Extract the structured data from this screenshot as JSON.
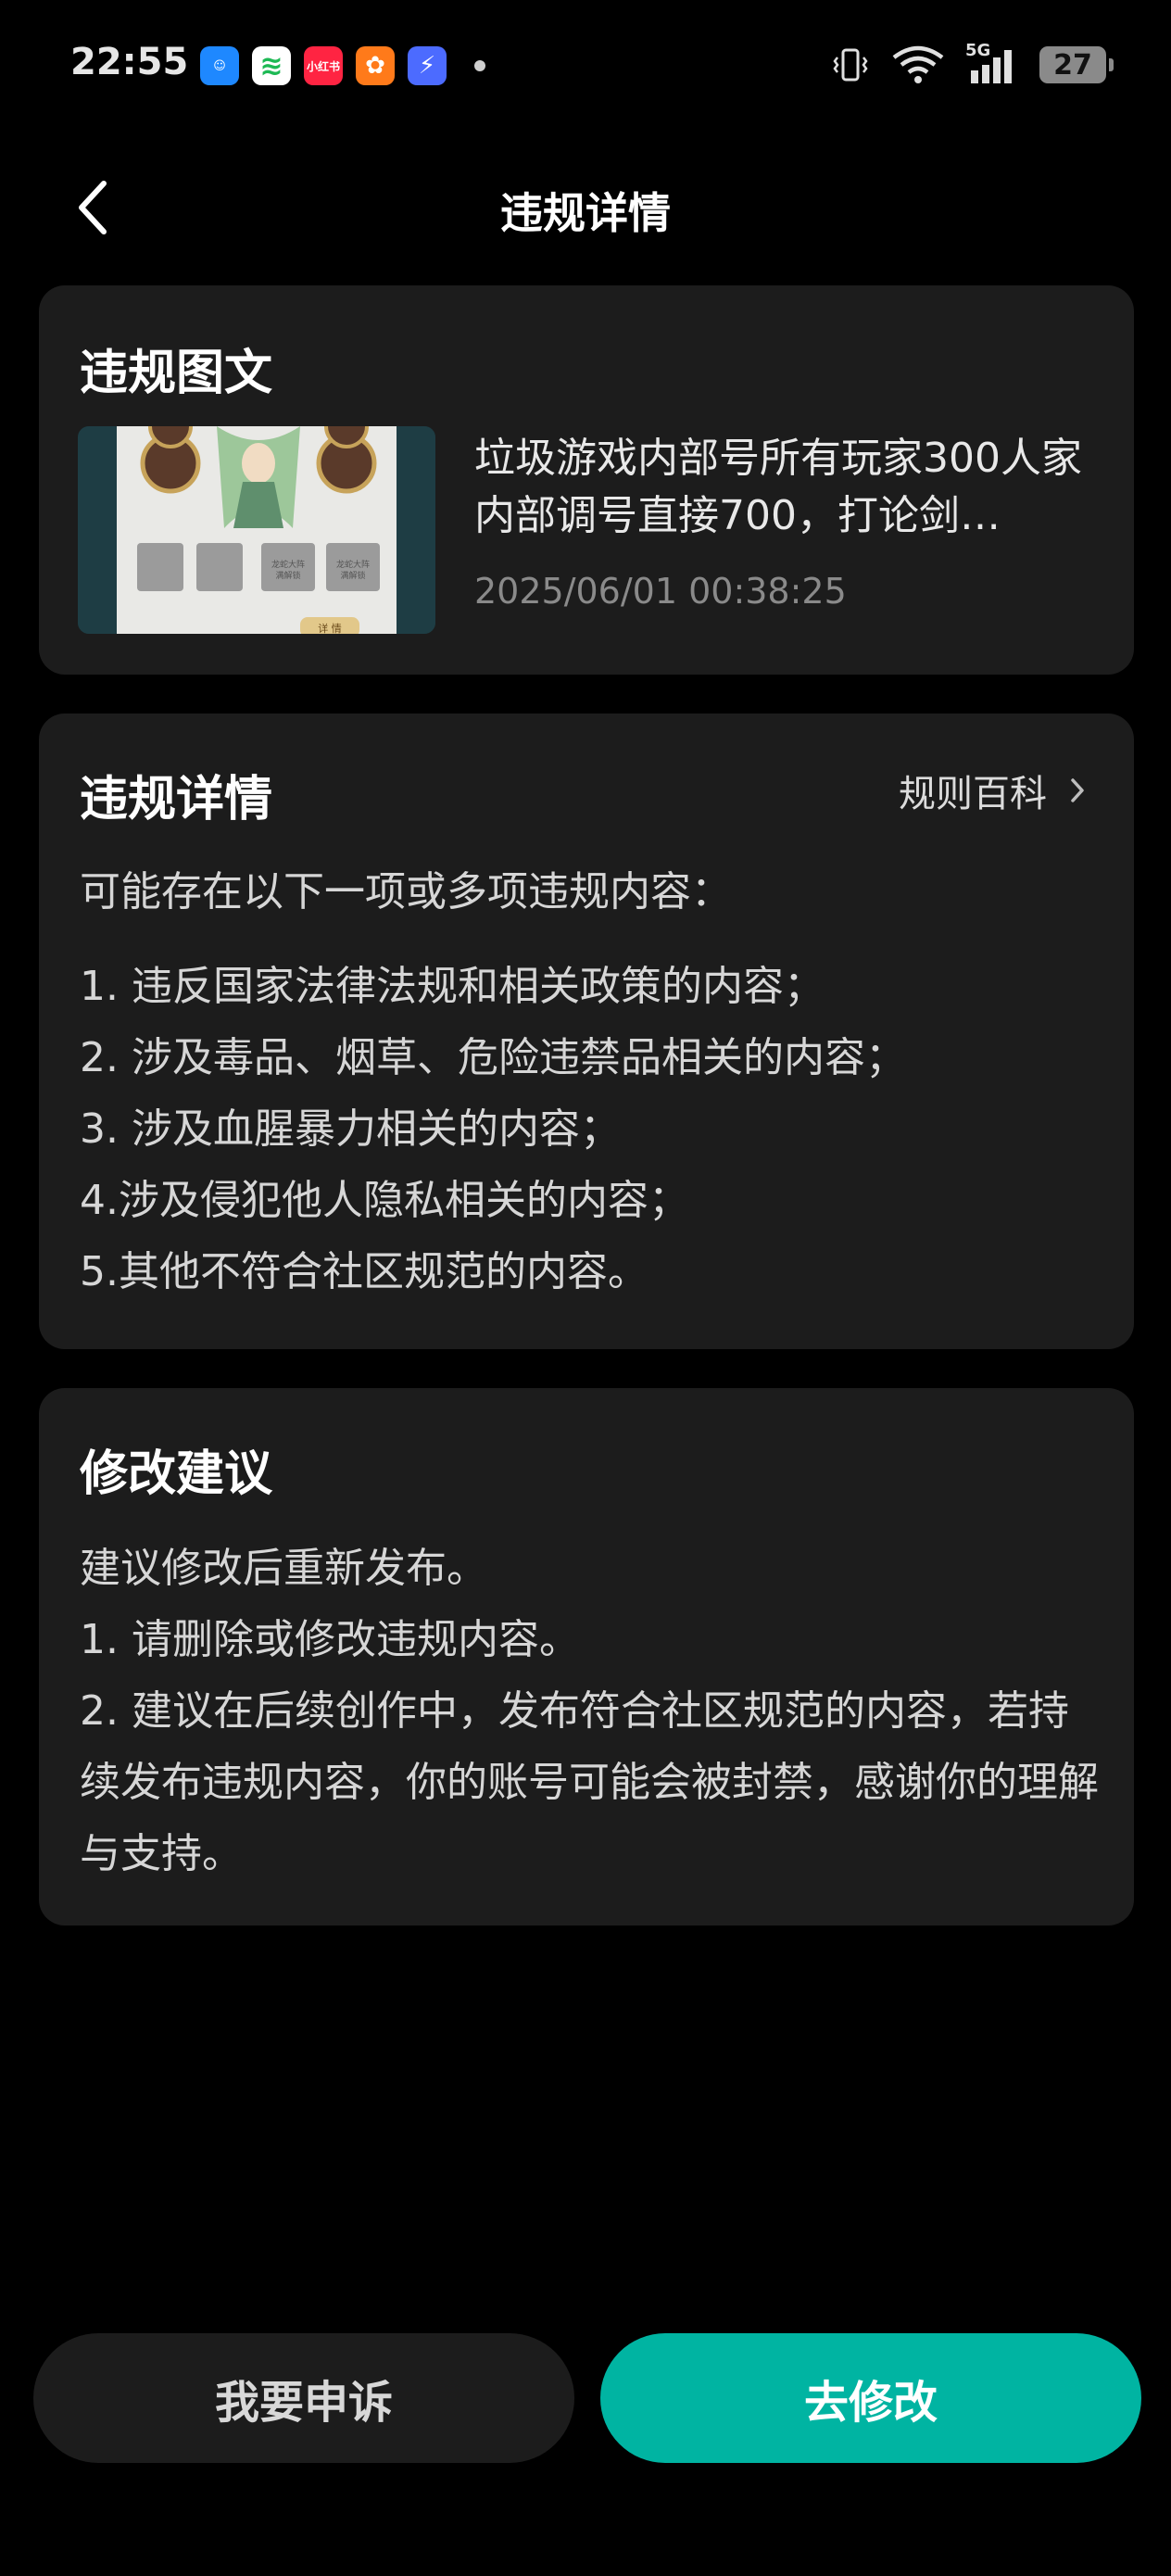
{
  "status_bar": {
    "time": "22:55",
    "app_icons": [
      {
        "name": "qq-app-icon",
        "glyph": "☺",
        "color": "#1e88ff"
      },
      {
        "name": "spotify-app-icon",
        "glyph": "≋",
        "color": "#1db954"
      },
      {
        "name": "xiaohongshu-app-icon",
        "glyph": "小红书",
        "color": "#ff2442"
      },
      {
        "name": "orange-app-icon",
        "glyph": "✿",
        "color": "#ff7a1a"
      },
      {
        "name": "lightning-app-icon",
        "glyph": "⚡",
        "color": "#4c6bff"
      }
    ],
    "network": "5G",
    "battery": "27"
  },
  "header": {
    "title": "违规详情"
  },
  "post_card": {
    "title": "违规图文",
    "text": "垃圾游戏内部号所有玩家300人家内部调号直接700，打论剑…",
    "time": "2025/06/01 00:38:25",
    "thumbnail_labels": [
      "龙蛇大阵 满解锁",
      "龙蛇大阵 满解锁",
      "详情"
    ]
  },
  "detail_card": {
    "title": "违规详情",
    "link_label": "规则百科",
    "intro": "可能存在以下一项或多项违规内容：",
    "items": [
      "1. 违反国家法律法规和相关政策的内容；",
      "2. 涉及毒品、烟草、危险违禁品相关的内容；",
      "3. 涉及血腥暴力相关的内容；",
      "4.涉及侵犯他人隐私相关的内容；",
      "5.其他不符合社区规范的内容。"
    ]
  },
  "suggest_card": {
    "title": "修改建议",
    "lines": [
      "建议修改后重新发布。",
      "1. 请删除或修改违规内容。",
      "2. 建议在后续创作中，发布符合社区规范的内容，若持续发布违规内容，你的账号可能会被封禁，感谢你的理解与支持。"
    ]
  },
  "buttons": {
    "appeal": "我要申诉",
    "edit": "去修改"
  },
  "colors": {
    "background": "#000000",
    "card": "#1c1c1c",
    "accent": "#00b4a2"
  }
}
